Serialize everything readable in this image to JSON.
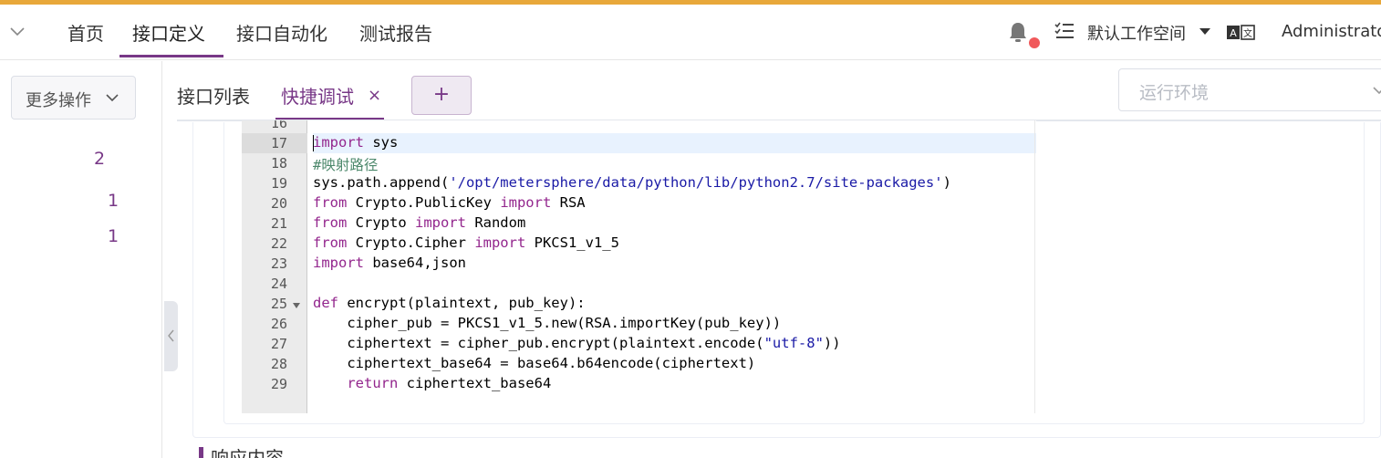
{
  "colors": {
    "accent": "#783887",
    "topline": "#e8a83a",
    "badge": "#f0595b"
  },
  "header": {
    "nav": [
      "首页",
      "接口定义",
      "接口自动化",
      "测试报告"
    ],
    "active_nav": "接口定义",
    "workspace": "默认工作空间",
    "user": "Administrator",
    "icons": [
      "chevron-down-icon",
      "bell-icon",
      "list-icon",
      "translate-icon"
    ]
  },
  "left": {
    "more_actions": "更多操作",
    "counts": [
      "2",
      "1",
      "1"
    ]
  },
  "tabs": {
    "list": "接口列表",
    "debug": "快捷调试",
    "close": "×",
    "add": "+"
  },
  "env": {
    "placeholder": "运行环境"
  },
  "editor": {
    "active_line": 17,
    "lines": [
      {
        "n": "16",
        "t": ""
      },
      {
        "n": "17",
        "t": "import sys"
      },
      {
        "n": "18",
        "t": "#映射路径"
      },
      {
        "n": "19",
        "t": "sys.path.append('/opt/metersphere/data/python/lib/python2.7/site-packages')"
      },
      {
        "n": "20",
        "t": "from Crypto.PublicKey import RSA"
      },
      {
        "n": "21",
        "t": "from Crypto import Random"
      },
      {
        "n": "22",
        "t": "from Crypto.Cipher import PKCS1_v1_5"
      },
      {
        "n": "23",
        "t": "import base64,json"
      },
      {
        "n": "24",
        "t": ""
      },
      {
        "n": "25",
        "t": "def encrypt(plaintext, pub_key):"
      },
      {
        "n": "26",
        "t": "    cipher_pub = PKCS1_v1_5.new(RSA.importKey(pub_key))"
      },
      {
        "n": "27",
        "t": "    ciphertext = cipher_pub.encrypt(plaintext.encode(\"utf-8\"))"
      },
      {
        "n": "28",
        "t": "    ciphertext_base64 = base64.b64encode(ciphertext)"
      },
      {
        "n": "29",
        "t": "    return ciphertext_base64"
      }
    ]
  },
  "section": {
    "title": "响应内容"
  }
}
